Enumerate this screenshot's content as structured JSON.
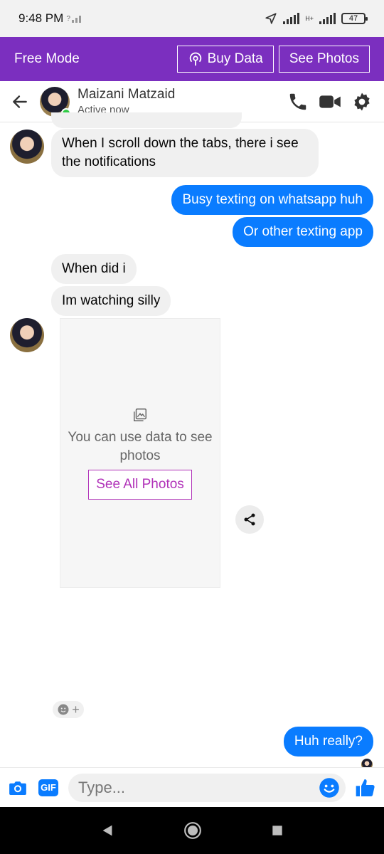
{
  "status_bar": {
    "time": "9:48 PM",
    "network_small": "?",
    "network_type": "H+",
    "battery": "47"
  },
  "free_mode": {
    "title": "Free Mode",
    "buy_data_label": "Buy Data",
    "see_photos_label": "See Photos"
  },
  "header": {
    "contact_name": "Maizani Matzaid",
    "status": "Active now"
  },
  "messages": [
    {
      "side": "in",
      "text": "When I scroll down the tabs, there i see the notifications"
    },
    {
      "side": "out",
      "text": "Busy texting on whatsapp huh"
    },
    {
      "side": "out",
      "text": "Or other texting app"
    },
    {
      "side": "in",
      "text": "When did i"
    },
    {
      "side": "in",
      "text": "Im watching silly"
    },
    {
      "side": "out",
      "text": "Huh really?"
    }
  ],
  "photo_placeholder": {
    "text": "You can use data to see photos",
    "button_label": "See All Photos"
  },
  "composer": {
    "placeholder": "Type..."
  },
  "colors": {
    "brand": "#7b2fbf",
    "outgoing": "#0a7cff",
    "incoming": "#f0f0f0",
    "accent_pink": "#b030b8"
  },
  "icons": [
    "back-arrow-icon",
    "phone-icon",
    "video-icon",
    "gear-icon",
    "camera-icon",
    "gif-icon",
    "emoji-icon",
    "thumbs-up-icon",
    "share-icon",
    "image-icon"
  ]
}
